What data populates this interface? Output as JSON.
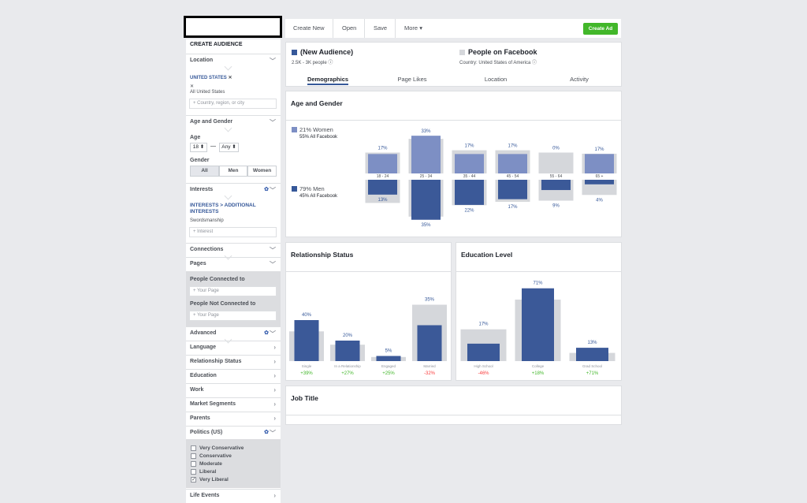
{
  "sidebar": {
    "create_audience": "CREATE AUDIENCE",
    "location_label": "Location",
    "location_selected": "UNITED STATES",
    "location_sub": "All United States",
    "location_placeholder": "Country, region, or city",
    "age_gender_label": "Age and Gender",
    "age_label": "Age",
    "age_min": "18",
    "age_dash": "—",
    "age_max": "Any",
    "gender_label": "Gender",
    "gender_options": [
      "All",
      "Men",
      "Women"
    ],
    "interests_label": "Interests",
    "interests_link": "INTERESTS > ADDITIONAL INTERESTS",
    "interest_selected": "Swordsmanship",
    "interest_placeholder": "Interest",
    "connections_label": "Connections",
    "pages_label": "Pages",
    "people_connected": "People Connected to",
    "people_not_connected": "People Not Connected to",
    "your_page_placeholder": "Your Page",
    "advanced_label": "Advanced",
    "rows": [
      "Language",
      "Relationship Status",
      "Education",
      "Work",
      "Market Segments",
      "Parents"
    ],
    "politics_label": "Politics (US)",
    "politics_options": [
      {
        "label": "Very Conservative",
        "checked": false
      },
      {
        "label": "Conservative",
        "checked": false
      },
      {
        "label": "Moderate",
        "checked": false
      },
      {
        "label": "Liberal",
        "checked": false
      },
      {
        "label": "Very Liberal",
        "checked": true
      }
    ],
    "life_events_label": "Life Events"
  },
  "toolbar": {
    "create_new": "Create New",
    "open": "Open",
    "save": "Save",
    "more": "More",
    "create_ad": "Create Ad"
  },
  "header": {
    "audience_name": "(New Audience)",
    "audience_size": "2.5K - 3K people",
    "compare_name": "People on Facebook",
    "compare_sub": "Country: United States of America",
    "tabs": [
      "Demographics",
      "Page Likes",
      "Location",
      "Activity"
    ]
  },
  "age_gender": {
    "title": "Age and Gender",
    "women_pct": "21% Women",
    "women_fb": "55% All Facebook",
    "men_pct": "79% Men",
    "men_fb": "45% All Facebook"
  },
  "relationship": {
    "title": "Relationship Status"
  },
  "education": {
    "title": "Education Level"
  },
  "job": {
    "title": "Job Title"
  },
  "chart_data": [
    {
      "type": "bar",
      "title": "Age and Gender",
      "categories": [
        "18 - 24",
        "25 - 34",
        "35 - 44",
        "45 - 54",
        "55 - 64",
        "65 +"
      ],
      "series": [
        {
          "name": "21% Women",
          "values": [
            17,
            33,
            17,
            17,
            0,
            17
          ]
        },
        {
          "name": "79% Men",
          "values": [
            13,
            35,
            22,
            17,
            9,
            4
          ]
        }
      ],
      "women_labels": [
        "17%",
        "33%",
        "17%",
        "17%",
        "0%",
        "17%"
      ],
      "men_labels": [
        "13%",
        "35%",
        "22%",
        "17%",
        "9%",
        "4%"
      ],
      "baseline_women": [
        10,
        22,
        12,
        12,
        10,
        9
      ],
      "baseline_men": [
        12,
        24,
        14,
        11,
        10,
        5
      ]
    },
    {
      "type": "bar",
      "title": "Relationship Status",
      "categories": [
        "Single",
        "In a Relationship",
        "Engaged",
        "Married"
      ],
      "values": [
        40,
        20,
        5,
        35
      ],
      "labels": [
        "40%",
        "20%",
        "5%",
        "35%"
      ],
      "baseline": [
        29,
        16,
        4,
        55
      ],
      "deltas": [
        "+39%",
        "+27%",
        "+25%",
        "-32%"
      ]
    },
    {
      "type": "bar",
      "title": "Education Level",
      "categories": [
        "High School",
        "College",
        "Grad School"
      ],
      "values": [
        17,
        71,
        13
      ],
      "labels": [
        "17%",
        "71%",
        "13%"
      ],
      "baseline": [
        31,
        60,
        8
      ],
      "deltas": [
        "-46%",
        "+18%",
        "+71%"
      ]
    }
  ],
  "colors": {
    "primary": "#365899",
    "bar": "#3b5998",
    "bar_light": "#7d8fc4",
    "baseline": "#d5d7db",
    "positive": "#42b72a",
    "negative": "#fa3e3e",
    "create": "#42b72a"
  }
}
